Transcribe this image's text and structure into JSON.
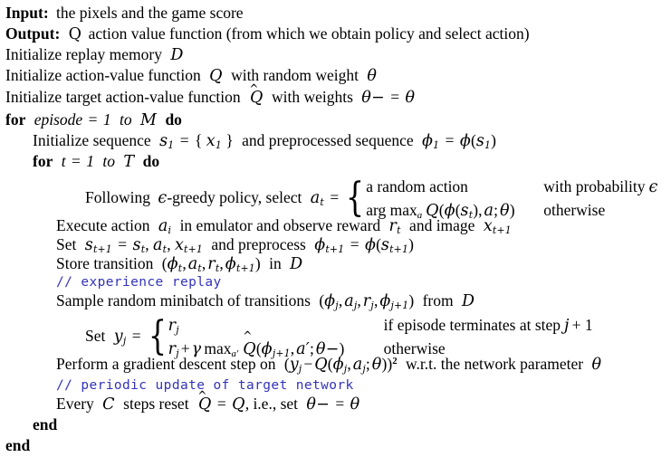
{
  "document": {
    "type": "algorithm-pseudocode",
    "title": "Deep Q-learning with experience replay",
    "comment_color": "#3333bb",
    "text_color": "#000000",
    "background_color": "#ffffff"
  },
  "lines": {
    "input_label": "Input:",
    "input_text": "the pixels and the game score",
    "output_label": "Output:",
    "output_q": "Q",
    "output_text": "action value function (from which we obtain policy and select action)",
    "init_replay_pre": "Initialize replay memory",
    "init_replay_sym": "D",
    "init_q_pre": "Initialize action-value function",
    "init_q_sym": "Q",
    "init_q_mid": "with random weight",
    "init_q_theta": "θ",
    "init_target_pre": "Initialize target action-value function",
    "init_target_sym": "Q",
    "init_target_mid": "with weights",
    "init_target_theta_minus": "θ−",
    "init_target_eq": "=",
    "init_target_theta": "θ",
    "for_episode_kw": "for",
    "for_episode_var": "episode",
    "for_episode_eq": "=",
    "for_episode_from": "1",
    "for_episode_to": "to",
    "for_episode_end": "M",
    "for_episode_do": "do",
    "init_seq_pre": "Initialize sequence",
    "init_seq_s1": "s",
    "init_seq_s1_sub": "1",
    "init_seq_eq": "=",
    "init_seq_set_open": "{",
    "init_seq_x1": "x",
    "init_seq_x1_sub": "1",
    "init_seq_set_close": "}",
    "init_seq_mid": "and preprocessed sequence",
    "init_seq_phi1": "ϕ",
    "init_seq_phi1_sub": "1",
    "init_seq_eq2": "=",
    "init_seq_phi": "ϕ",
    "init_seq_of_s1": "s",
    "init_seq_of_s1_sub": "1",
    "for_t_kw": "for",
    "for_t_var": "t",
    "for_t_eq": "=",
    "for_t_from": "1",
    "for_t_to": "to",
    "for_t_end": "T",
    "for_t_do": "do",
    "policy_lead": "Following",
    "policy_eps": "ϵ",
    "policy_mid": "-greedy policy, select",
    "policy_at": "a",
    "policy_at_sub": "t",
    "policy_eq": "=",
    "policy_case1_expr": "a random action",
    "policy_case1_cond": "with probability",
    "policy_case1_cond_eps": "ϵ",
    "policy_case2_argmax": "arg max",
    "policy_case2_argmax_sub": "a",
    "policy_case2_q": "Q",
    "policy_case2_phi": "ϕ",
    "policy_case2_st": "s",
    "policy_case2_st_sub": "t",
    "policy_case2_a": "a",
    "policy_case2_theta": "θ",
    "policy_case2_cond": "otherwise",
    "execute_pre": "Execute action",
    "execute_ai": "a",
    "execute_ai_sub": "i",
    "execute_mid": "in emulator and observe reward",
    "execute_rt": "r",
    "execute_rt_sub": "t",
    "execute_mid2": "and image",
    "execute_x": "x",
    "execute_x_sub": "t+1",
    "set_s_pre": "Set",
    "set_s_s": "s",
    "set_s_s_sub": "t+1",
    "set_s_eq": "=",
    "set_s_st": "s",
    "set_s_st_sub": "t",
    "set_s_at": "a",
    "set_s_at_sub": "t",
    "set_s_xt": "x",
    "set_s_xt_sub": "t+1",
    "set_s_mid": "and preprocess",
    "set_s_phi": "ϕ",
    "set_s_phi_sub": "t+1",
    "set_s_eq2": "=",
    "set_s_phi2": "ϕ",
    "set_s_phi2_s": "s",
    "set_s_phi2_s_sub": "t+1",
    "store_pre": "Store transition",
    "store_phi": "ϕ",
    "store_phi_sub": "t",
    "store_a": "a",
    "store_a_sub": "t",
    "store_r": "r",
    "store_r_sub": "t",
    "store_phi2": "ϕ",
    "store_phi2_sub": "t+1",
    "store_mid": "in",
    "store_d": "D",
    "comment_experience_replay": "// experience replay",
    "sample_pre": "Sample random minibatch of transitions",
    "sample_phi": "ϕ",
    "sample_phi_sub": "j",
    "sample_a": "a",
    "sample_a_sub": "j",
    "sample_r": "r",
    "sample_r_sub": "j",
    "sample_phi2": "ϕ",
    "sample_phi2_sub": "j+1",
    "sample_mid": "from",
    "sample_d": "D",
    "set_y_pre": "Set",
    "set_y_y": "y",
    "set_y_y_sub": "j",
    "set_y_eq": "=",
    "set_y_case1_r": "r",
    "set_y_case1_r_sub": "j",
    "set_y_case1_cond": "if episode terminates at step",
    "set_y_case1_cond_j": "j",
    "set_y_case1_cond_plus": "+ 1",
    "set_y_case2_r": "r",
    "set_y_case2_r_sub": "j",
    "set_y_case2_plus": "+",
    "set_y_case2_gamma": "γ",
    "set_y_case2_max": "max",
    "set_y_case2_max_sub": "a′",
    "set_y_case2_q": "Q",
    "set_y_case2_phi": "ϕ",
    "set_y_case2_phi_sub": "j+1",
    "set_y_case2_aprime": "a′",
    "set_y_case2_theta": "θ−",
    "set_y_case2_cond": "otherwise",
    "perform_pre": "Perform a gradient descent step on",
    "perform_y": "y",
    "perform_y_sub": "j",
    "perform_minus": "−",
    "perform_q": "Q",
    "perform_phi": "ϕ",
    "perform_phi_sub": "j",
    "perform_a": "a",
    "perform_a_sub": "j",
    "perform_theta": "θ",
    "perform_sup": "2",
    "perform_mid": "w.r.t. the network parameter",
    "perform_theta2": "θ",
    "comment_periodic_update": "// periodic update of target network",
    "every_pre": "Every",
    "every_c": "C",
    "every_mid": "steps reset",
    "every_qhat": "Q",
    "every_eq": "=",
    "every_q": "Q",
    "every_ie": ", i.e., set",
    "every_theta_minus": "θ−",
    "every_eq2": "=",
    "every_theta": "θ",
    "end_inner": "end",
    "end_outer": "end"
  }
}
